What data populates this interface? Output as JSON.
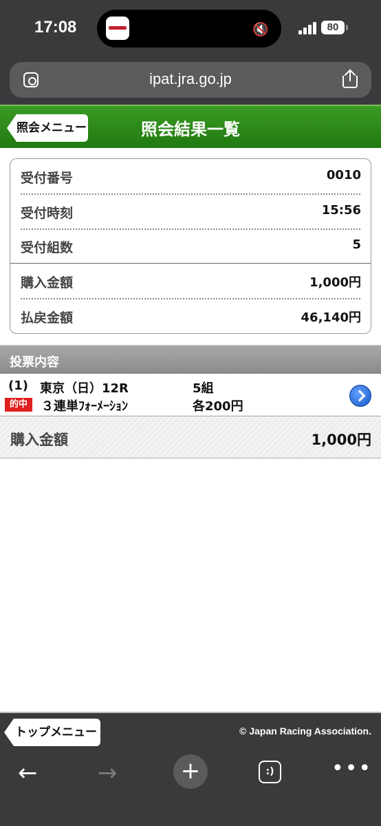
{
  "status": {
    "time": "17:08",
    "battery": "80"
  },
  "browser": {
    "url": "ipat.jra.go.jp"
  },
  "header": {
    "back_label": "照会メニュー",
    "title": "照会結果一覧"
  },
  "summary": {
    "rows": [
      {
        "label": "受付番号",
        "value": "0010"
      },
      {
        "label": "受付時刻",
        "value": "15:56"
      },
      {
        "label": "受付組数",
        "value": "5"
      },
      {
        "label": "購入金額",
        "value": "1,000円"
      },
      {
        "label": "払戻金額",
        "value": "46,140円"
      }
    ]
  },
  "section": {
    "title": "投票内容"
  },
  "bet": {
    "number": "(1)",
    "race": "東京（日）12R",
    "count": "5組",
    "badge": "的中",
    "type": "３連単ﾌｫｰﾒｰｼｮﾝ",
    "each": "各200円"
  },
  "purchase": {
    "label": "購入金額",
    "value": "1,000円"
  },
  "footer": {
    "top_label": "トップメニュー",
    "copyright": "© Japan Racing Association."
  },
  "toolbar": {
    "back": "←",
    "forward": "→",
    "plus": "+",
    "tabs": ":)",
    "more": "•••"
  }
}
